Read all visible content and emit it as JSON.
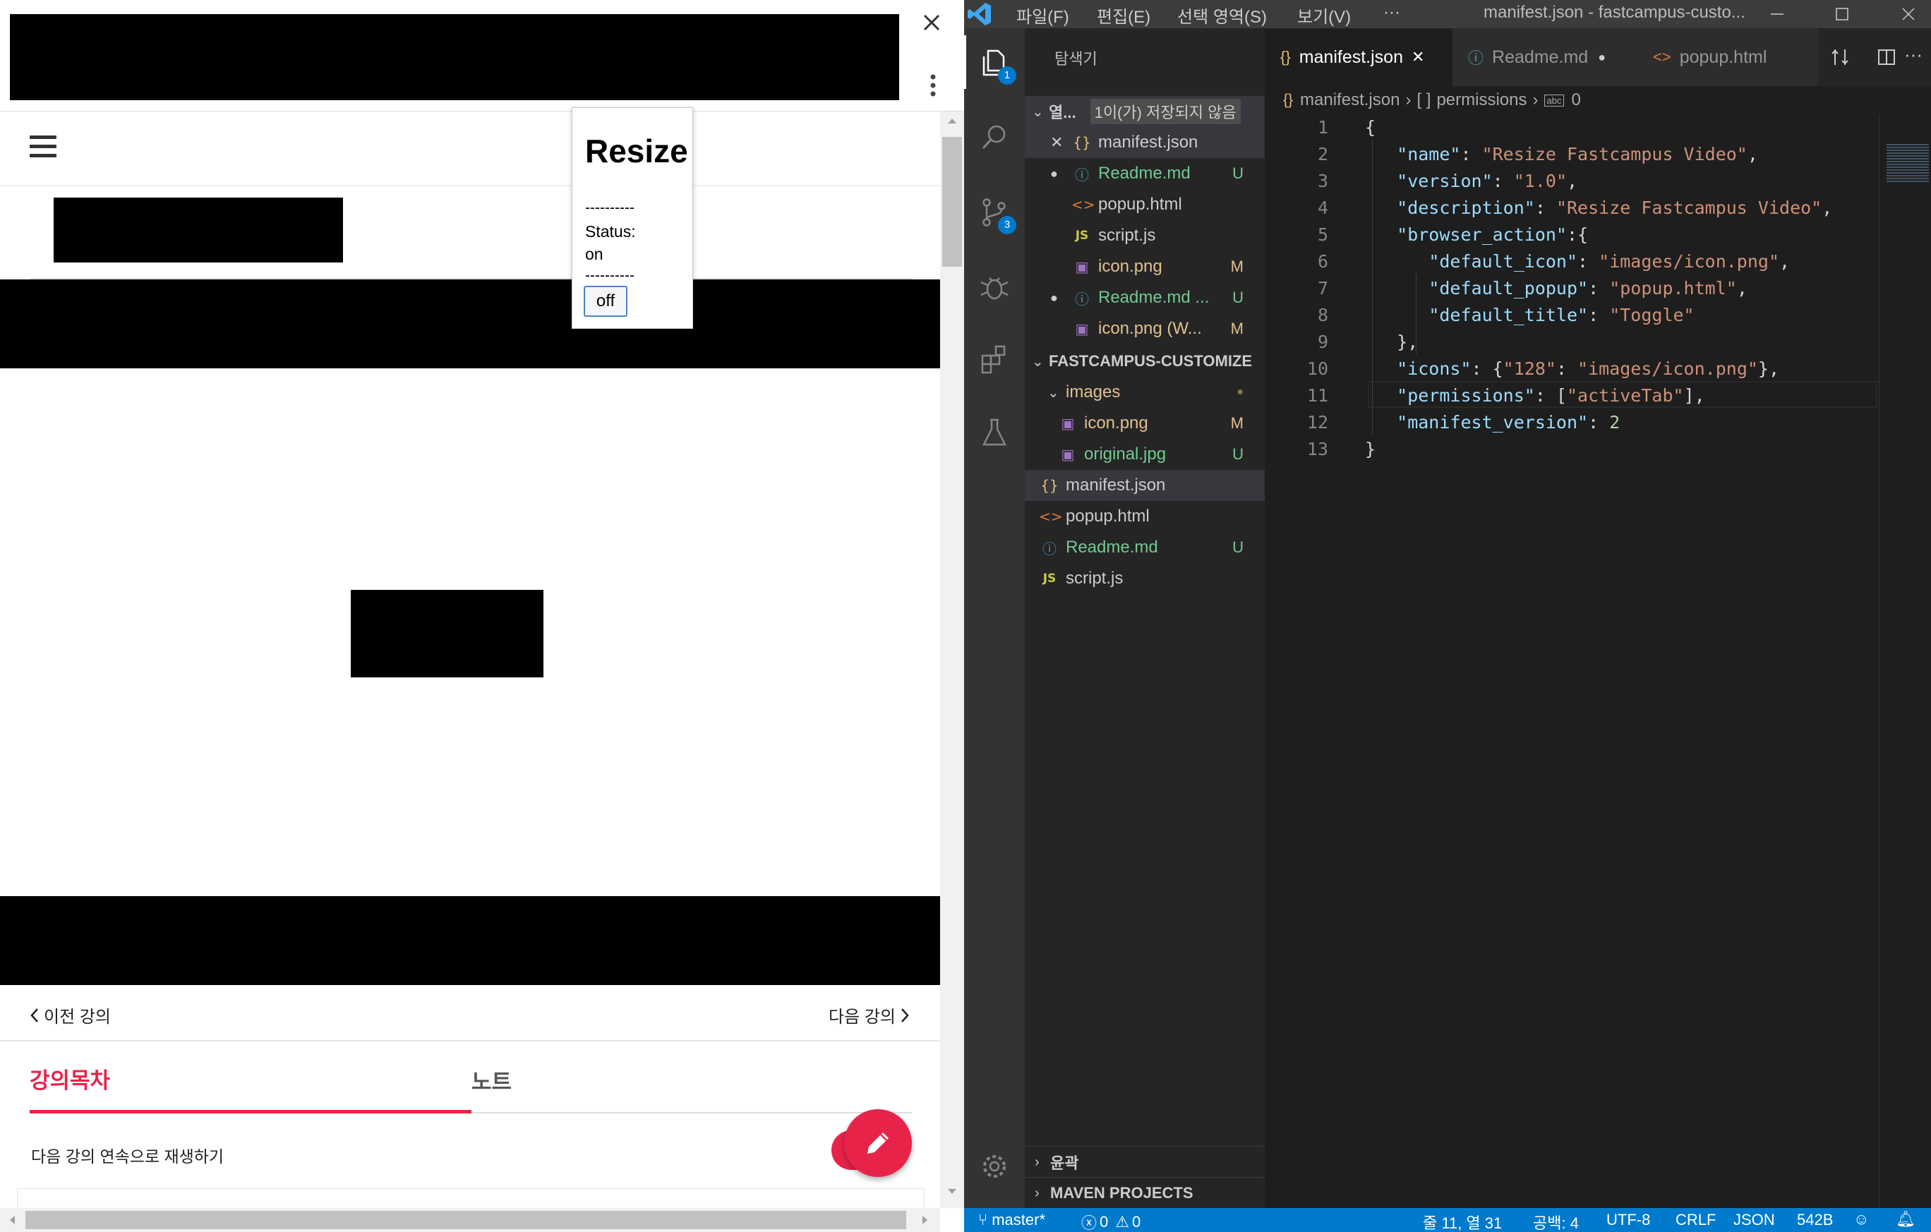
{
  "browser": {
    "prev_lecture": "이전 강의",
    "next_lecture": "다음 강의",
    "tabs": [
      "강의목차",
      "노트"
    ],
    "autoplay_label": "다음 강의 연속으로 재생하기"
  },
  "popup": {
    "title": "Resize",
    "divider": "----------",
    "status_label": "Status:",
    "status_value": "on",
    "button_label": "off"
  },
  "vscode": {
    "menu": [
      "파일(F)",
      "편집(E)",
      "선택 영역(S)",
      "보기(V)",
      "···"
    ],
    "window_title": "manifest.json - fastcampus-custo...",
    "explorer_title": "탐색기",
    "open_editors_label": "열...",
    "unsaved_label": "1이(가) 저장되지 않음",
    "open_editors": [
      {
        "name": "manifest.json",
        "status": ""
      },
      {
        "name": "Readme.md",
        "status": "U"
      },
      {
        "name": "popup.html",
        "status": ""
      },
      {
        "name": "script.js",
        "status": ""
      },
      {
        "name": "icon.png",
        "status": "M"
      },
      {
        "name": "Readme.md ...",
        "status": "U"
      },
      {
        "name": "icon.png (W...",
        "status": "M"
      }
    ],
    "project_label": "FASTCAMPUS-CUSTOMIZE",
    "tree": [
      {
        "name": "images",
        "status": "●"
      },
      {
        "name": "icon.png",
        "status": "M"
      },
      {
        "name": "original.jpg",
        "status": "U"
      },
      {
        "name": "manifest.json",
        "status": ""
      },
      {
        "name": "popup.html",
        "status": ""
      },
      {
        "name": "Readme.md",
        "status": "U"
      },
      {
        "name": "script.js",
        "status": ""
      }
    ],
    "outline_label": "윤곽",
    "maven_label": "MAVEN PROJECTS",
    "tabs": [
      {
        "label": "manifest.json"
      },
      {
        "label": "Readme.md"
      },
      {
        "label": "popup.html"
      }
    ],
    "breadcrumb": {
      "file": "manifest.json",
      "key": "permissions",
      "index": "0"
    },
    "line_numbers": [
      "1",
      "2",
      "3",
      "4",
      "5",
      "6",
      "7",
      "8",
      "9",
      "10",
      "11",
      "12",
      "13"
    ],
    "status_bar": {
      "branch": "master*",
      "errors": "0",
      "warnings": "0",
      "position": "줄 11, 열 31",
      "spaces": "공백: 4",
      "encoding": "UTF-8",
      "eol": "CRLF",
      "language": "JSON",
      "size": "542B"
    },
    "badges": {
      "explorer": "1",
      "scm": "3"
    }
  },
  "code": [
    [
      [
        "p",
        "{"
      ]
    ],
    [
      [
        "k",
        "\"name\""
      ],
      [
        "p",
        ": "
      ],
      [
        "s",
        "\"Resize Fastcampus Video\""
      ],
      [
        "p",
        ","
      ]
    ],
    [
      [
        "k",
        "\"version\""
      ],
      [
        "p",
        ": "
      ],
      [
        "s",
        "\"1.0\""
      ],
      [
        "p",
        ","
      ]
    ],
    [
      [
        "k",
        "\"description\""
      ],
      [
        "p",
        ": "
      ],
      [
        "s",
        "\"Resize Fastcampus Video\""
      ],
      [
        "p",
        ","
      ]
    ],
    [
      [
        "k",
        "\"browser_action\""
      ],
      [
        "p",
        ":{"
      ]
    ],
    [
      [
        "k",
        "\"default_icon\""
      ],
      [
        "p",
        ": "
      ],
      [
        "s",
        "\"images/icon.png\""
      ],
      [
        "p",
        ","
      ]
    ],
    [
      [
        "k",
        "\"default_popup\""
      ],
      [
        "p",
        ": "
      ],
      [
        "s",
        "\"popup.html\""
      ],
      [
        "p",
        ","
      ]
    ],
    [
      [
        "k",
        "\"default_title\""
      ],
      [
        "p",
        ": "
      ],
      [
        "s",
        "\"Toggle\""
      ]
    ],
    [
      [
        "p",
        "},"
      ]
    ],
    [
      [
        "k",
        "\"icons\""
      ],
      [
        "p",
        ": {"
      ],
      [
        "s",
        "\"128\""
      ],
      [
        "p",
        ": "
      ],
      [
        "s",
        "\"images/icon.png\""
      ],
      [
        "p",
        "},"
      ]
    ],
    [
      [
        "k",
        "\"permissions\""
      ],
      [
        "p",
        ": ["
      ],
      [
        "s",
        "\"activeTab\""
      ],
      [
        "p",
        "],"
      ]
    ],
    [
      [
        "k",
        "\"manifest_version\""
      ],
      [
        "p",
        ": "
      ],
      [
        "n",
        "2"
      ]
    ],
    [
      [
        "p",
        "}"
      ]
    ]
  ],
  "colors": {
    "accent_red": "#e8234a",
    "vscode_blue": "#007acc",
    "untracked_green": "#73c991",
    "modified_yellow": "#e2c08d"
  },
  "icons": [
    "hamburger-icon",
    "close-icon",
    "kebab-icon",
    "pencil-icon",
    "chevron-left-icon",
    "chevron-right-icon",
    "vscode-logo-icon",
    "explorer-icon",
    "search-icon",
    "source-control-icon",
    "debug-icon",
    "extensions-icon",
    "flask-icon",
    "gear-icon",
    "json-icon",
    "info-icon",
    "html-icon",
    "js-icon",
    "image-icon",
    "git-branch-icon",
    "error-icon",
    "warning-icon",
    "bell-icon",
    "feedback-icon"
  ]
}
